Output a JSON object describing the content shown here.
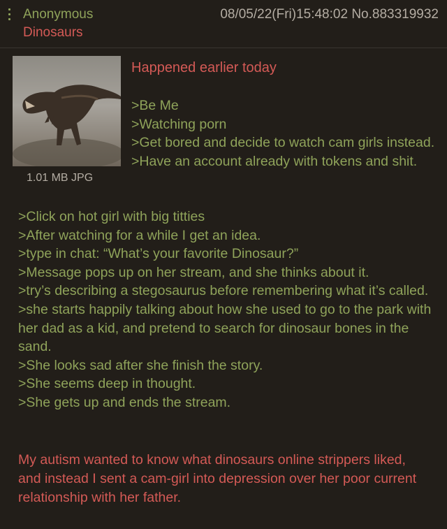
{
  "post": {
    "name": "Anonymous",
    "subject": "Dinosaurs",
    "datetime": "08/05/22(Fri)15:48:02",
    "post_number": "No.883319932",
    "file_info": "1.01 MB JPG",
    "opening_line": "Happened earlier today",
    "greentext_top": [
      ">Be Me",
      ">Watching porn",
      ">Get bored and decide to watch cam girls instead.",
      ">Have an account already with tokens and shit."
    ],
    "greentext_full": [
      ">Click on hot girl with big titties",
      ">After watching for a while I get an idea.",
      ">type in chat: “What’s your favorite Dinosaur?”",
      ">Message pops up on her stream, and she thinks about it.",
      ">try’s describing a stegosaurus before remembering what it’s called.",
      ">she starts happily talking about how she used to go to the park with her dad as a kid, and pretend to search for dinosaur bones in the sand.",
      ">She looks sad after she finish the story.",
      ">She seems deep in thought.",
      ">She gets up and ends the stream."
    ],
    "closing": "My autism wanted to know what dinosaurs online strippers liked, and instead I sent a cam-girl into depression over her poor current relationship with her father."
  },
  "icons": {
    "menu": "vertical-dots-icon",
    "thumbnail": "dinosaur-image"
  },
  "colors": {
    "background": "#221e19",
    "greentext": "#8fa35a",
    "redtext": "#d45a56",
    "meta": "#b4ada3"
  }
}
